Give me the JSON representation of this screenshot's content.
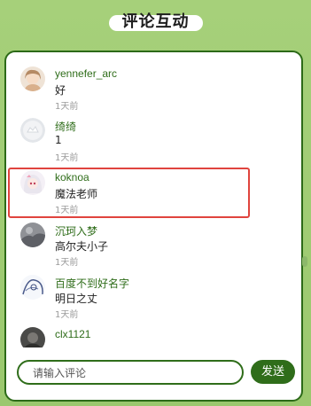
{
  "header": {
    "title": "评论互动"
  },
  "comments": [
    {
      "username": "yennefer_arc",
      "text": "好",
      "time": "1天前",
      "avatar": "anime-girl-avatar"
    },
    {
      "username": "绮绮",
      "text": "1",
      "time": "1天前",
      "avatar": "default-avatar"
    },
    {
      "username": "koknoa",
      "text": "魔法老师",
      "time": "1天前",
      "avatar": "anime-white-hair-avatar",
      "selected": true
    },
    {
      "username": "沉珂入梦",
      "text": "高尔夫小子",
      "time": "1天前",
      "avatar": "gray-photo-avatar"
    },
    {
      "username": "百度不到好名字",
      "text": "明日之丈",
      "time": "1天前",
      "avatar": "sketch-avatar"
    },
    {
      "username": "clx1121",
      "text": "",
      "time": "",
      "avatar": "dark-photo-avatar"
    }
  ],
  "input": {
    "placeholder": "请输入评论",
    "value": ""
  },
  "send_button": {
    "label": "发送"
  },
  "colors": {
    "accent": "#2f6d1a",
    "background": "#a6d07a",
    "highlight_border": "#e0443e"
  }
}
